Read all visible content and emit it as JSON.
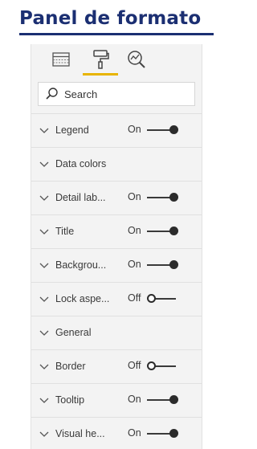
{
  "title": "Panel de formato",
  "colors": {
    "title": "#1b2f72",
    "tab_active": "#e8b400",
    "panel_bg": "#f3f3f3"
  },
  "tabs": [
    {
      "icon": "fields-table-icon",
      "active": false
    },
    {
      "icon": "paint-roller-icon",
      "active": true
    },
    {
      "icon": "analytics-magnifier-icon",
      "active": false
    }
  ],
  "search": {
    "placeholder": "Search",
    "icon": "search-icon"
  },
  "rows": [
    {
      "label": "Legend",
      "toggle": "On"
    },
    {
      "label": "Data colors",
      "toggle": null
    },
    {
      "label": "Detail lab...",
      "toggle": "On"
    },
    {
      "label": "Title",
      "toggle": "On"
    },
    {
      "label": "Backgrou...",
      "toggle": "On"
    },
    {
      "label": "Lock aspe...",
      "toggle": "Off"
    },
    {
      "label": "General",
      "toggle": null
    },
    {
      "label": "Border",
      "toggle": "Off"
    },
    {
      "label": "Tooltip",
      "toggle": "On"
    },
    {
      "label": "Visual he...",
      "toggle": "On"
    }
  ]
}
